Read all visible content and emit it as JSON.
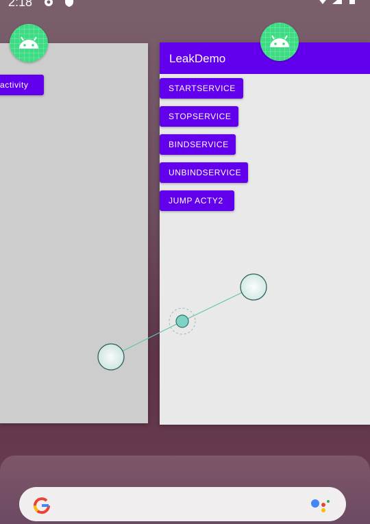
{
  "status_bar": {
    "time": "2:18",
    "icons": [
      "settings-icon",
      "shield-icon",
      "wifi-icon",
      "signal-icon",
      "battery-icon"
    ]
  },
  "recents": {
    "left_card": {
      "visible_button_label": "activity"
    },
    "right_card": {
      "app_title": "LeakDemo",
      "buttons": [
        {
          "label": "STARTSERVICE"
        },
        {
          "label": "STOPSERVICE"
        },
        {
          "label": "BINDSERVICE"
        },
        {
          "label": "UNBINDSERVICE"
        },
        {
          "label": "JUMP ACTY2"
        }
      ]
    }
  },
  "overlay": {
    "gesture": "pinch-touch-indicator"
  },
  "dock": {
    "search_icons": [
      "google-g-icon",
      "google-assistant-icon"
    ]
  },
  "colors": {
    "primary": "#6200ee",
    "android_green": "#3ddc84",
    "touch_fill": "#7ed3c6"
  }
}
